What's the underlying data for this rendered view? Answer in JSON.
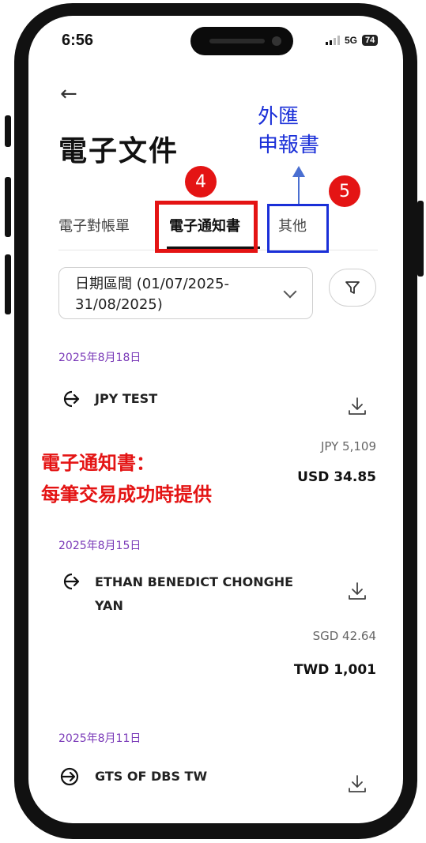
{
  "status_bar": {
    "time": "6:56",
    "network": "5G",
    "battery": "74"
  },
  "header": {
    "back_glyph": "←",
    "title": "電子文件"
  },
  "tabs": [
    {
      "label": "電子對帳單"
    },
    {
      "label": "電子通知書"
    },
    {
      "label": "其他"
    }
  ],
  "filter": {
    "date_range": "日期區間 (01/07/2025-31/08/2025)"
  },
  "annotations": {
    "badge4": "4",
    "badge5": "5",
    "blue_line1": "外匯",
    "blue_line2": "申報書",
    "red_line1": "電子通知書：",
    "red_line2": "每筆交易成功時提供"
  },
  "transactions": [
    {
      "date": "2025年8月18日",
      "name": "JPY TEST",
      "amount_original": "JPY 5,109",
      "amount_converted": "USD 34.85",
      "icon": "outgoing-arrow-icon"
    },
    {
      "date": "2025年8月15日",
      "name": "ETHAN BENEDICT CHONGHE YAN",
      "amount_original": "SGD 42.64",
      "amount_converted": "TWD 1,001",
      "icon": "outgoing-arrow-icon"
    },
    {
      "date": "2025年8月11日",
      "name": "GTS OF DBS TW",
      "amount_original": "",
      "amount_converted": "",
      "icon": "incoming-arrow-icon"
    }
  ],
  "colors": {
    "highlight_red": "#e41414",
    "highlight_blue": "#1a2fd8",
    "date_purple": "#7a3ab8"
  }
}
